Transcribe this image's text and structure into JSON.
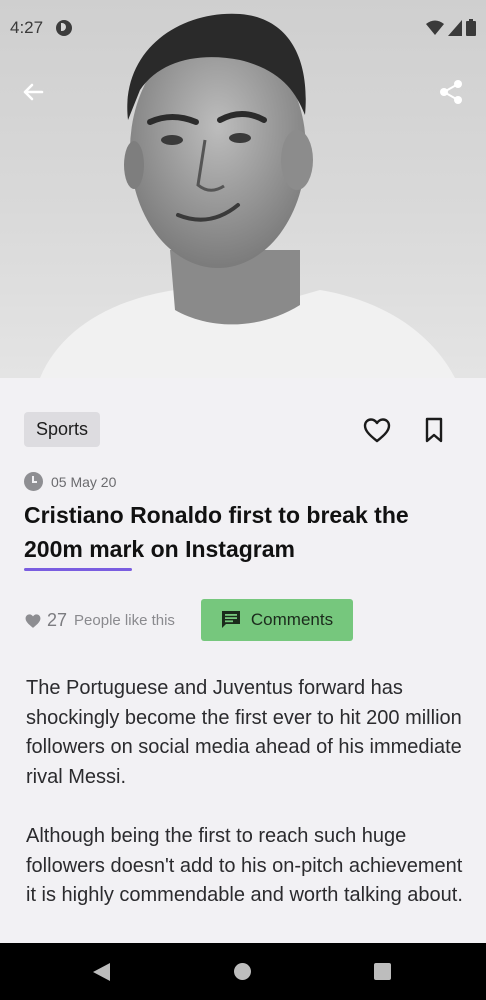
{
  "status_bar": {
    "time": "4:27"
  },
  "article": {
    "category": "Sports",
    "date": "05 May 20",
    "title": "Cristiano Ronaldo first to break the 200m mark on Instagram",
    "likes_count": "27",
    "likes_text": "People like this",
    "comments_label": "Comments",
    "paragraphs": [
      "The Portuguese and Juventus forward has shockingly become the first ever to hit 200 million followers on social media ahead of his immediate rival Messi.",
      "Although being the first to reach such huge followers doesn't add to his on-pitch achievement it is highly commendable and worth talking about."
    ]
  },
  "colors": {
    "accent_underline": "#7a5de0",
    "comments_button": "#76c77d",
    "background": "#f2f1f4"
  },
  "icons": [
    "back-arrow-icon",
    "share-icon",
    "heart-outline-icon",
    "bookmark-icon",
    "clock-icon",
    "heart-icon",
    "comment-icon"
  ]
}
